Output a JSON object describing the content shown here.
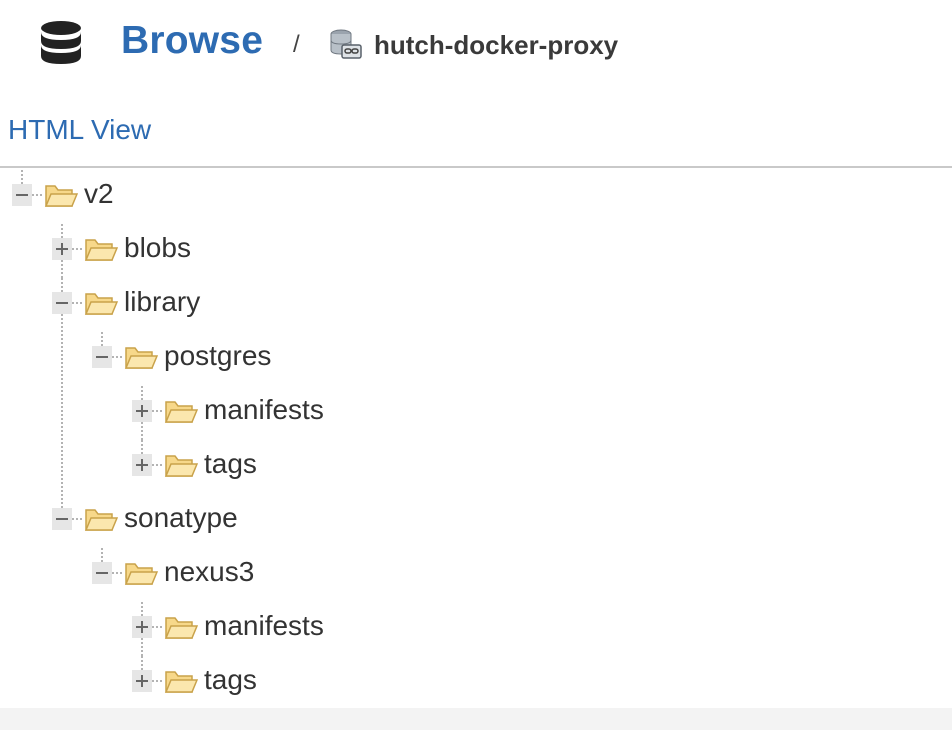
{
  "header": {
    "title": "Browse",
    "separator": "/",
    "repository": "hutch-docker-proxy"
  },
  "view_link": "HTML View",
  "tree": [
    {
      "label": "v2",
      "depth": 0,
      "toggle": "collapse"
    },
    {
      "label": "blobs",
      "depth": 1,
      "toggle": "expand"
    },
    {
      "label": "library",
      "depth": 1,
      "toggle": "collapse"
    },
    {
      "label": "postgres",
      "depth": 2,
      "toggle": "collapse"
    },
    {
      "label": "manifests",
      "depth": 3,
      "toggle": "expand"
    },
    {
      "label": "tags",
      "depth": 3,
      "toggle": "expand"
    },
    {
      "label": "sonatype",
      "depth": 1,
      "toggle": "collapse"
    },
    {
      "label": "nexus3",
      "depth": 2,
      "toggle": "collapse"
    },
    {
      "label": "manifests",
      "depth": 3,
      "toggle": "expand"
    },
    {
      "label": "tags",
      "depth": 3,
      "toggle": "expand"
    }
  ],
  "colors": {
    "link": "#2d6bb2",
    "folder_fill": "#f7d88a",
    "folder_stroke": "#c9a24a"
  }
}
